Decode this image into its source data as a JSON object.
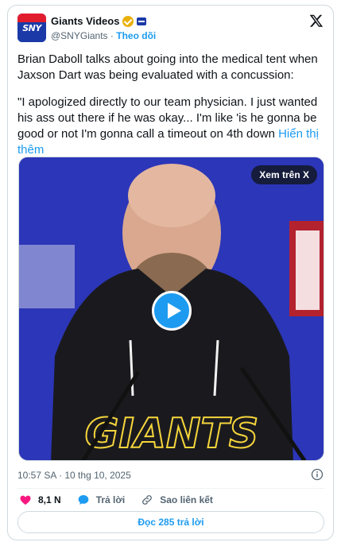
{
  "author": {
    "name": "Giants Videos",
    "handle": "@SNYGiants",
    "separator": "·",
    "follow_label": "Theo dõi",
    "avatar_text": "SNY"
  },
  "tweet": {
    "paragraph1": "Brian Daboll talks about going into the medical tent when Jaxson Dart was being evaluated with a concussion:",
    "paragraph2": "\"I apologized directly to our team physician. I just wanted his ass out there if he was okay... I'm like 'is he gonna be good or not I'm gonna call a timeout on 4th down",
    "show_more": "Hiển thị thêm"
  },
  "media": {
    "watch_on_x": "Xem trên X",
    "hoodie_text": "GIANTS",
    "colors": {
      "backdrop": "#2c36b8",
      "hoodie": "#1a1a1e"
    }
  },
  "meta": {
    "timestamp": "10:57 SA · 10 thg 10, 2025"
  },
  "actions": {
    "like_count": "8,1 N",
    "reply_label": "Trả lời",
    "copy_link_label": "Sao liên kết"
  },
  "read_replies_label": "Đọc 285 trả lời",
  "colors": {
    "accent": "#1d9bf0",
    "like": "#f91880",
    "text": "#0f1419",
    "muted": "#536471"
  }
}
